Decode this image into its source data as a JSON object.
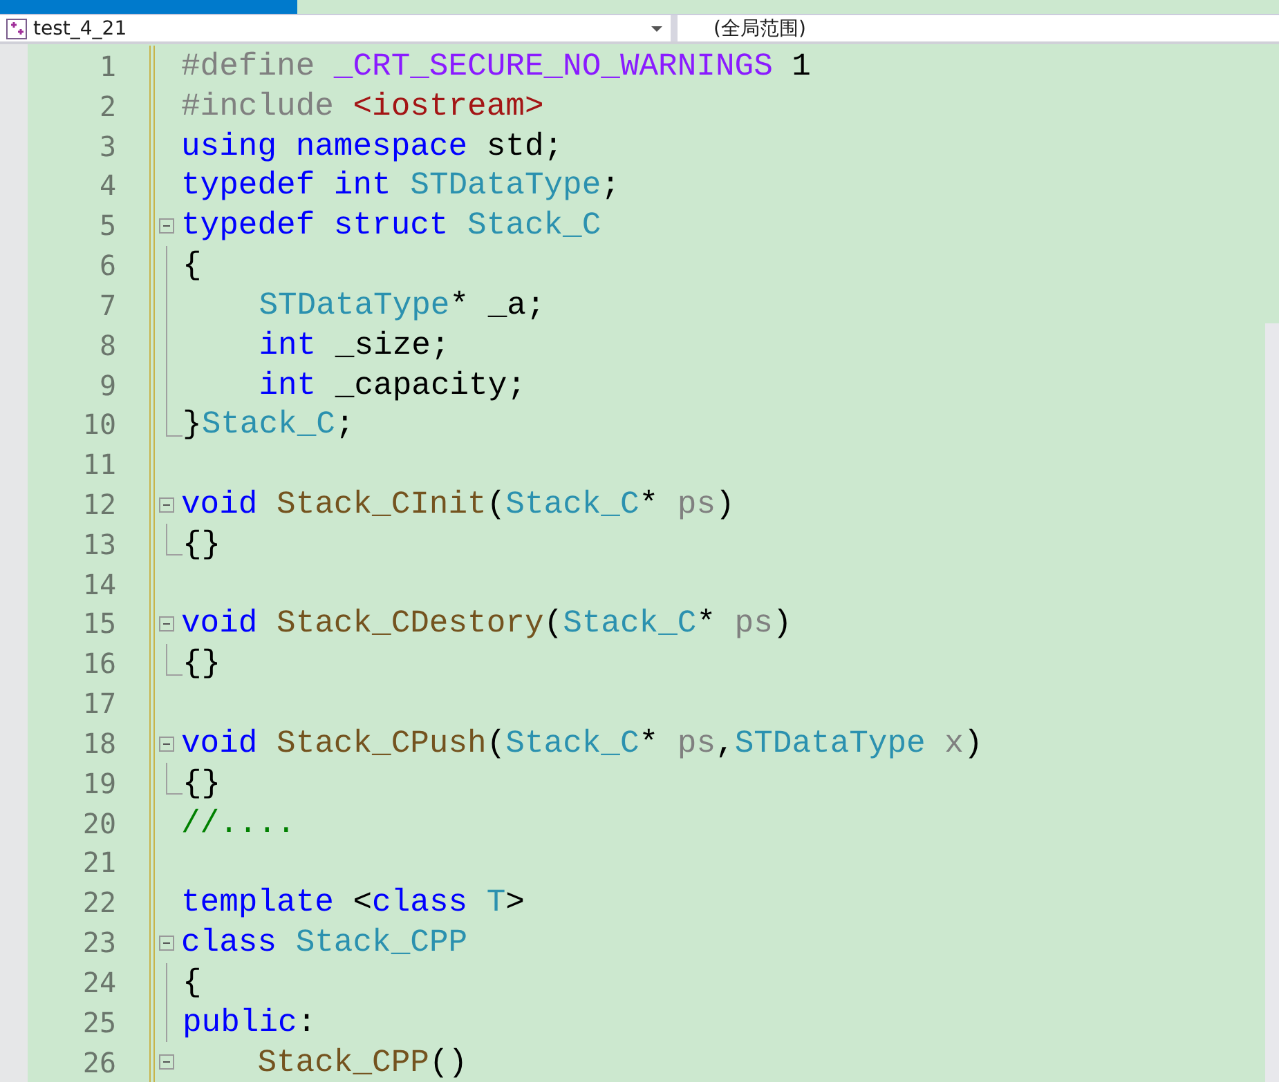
{
  "navigation_bar": {
    "project": "test_4_21",
    "scope": "(全局范围)"
  },
  "editor": {
    "lines": [
      {
        "number": "1",
        "kind": "plain",
        "tokens": [
          {
            "kind": "pre",
            "text": "#define "
          },
          {
            "kind": "macro",
            "text": "_CRT_SECURE_NO_WARNINGS"
          },
          {
            "kind": "plain",
            "text": " 1"
          }
        ]
      },
      {
        "number": "2",
        "kind": "plain",
        "tokens": [
          {
            "kind": "pre",
            "text": "#include "
          },
          {
            "kind": "str",
            "text": "<iostream>"
          }
        ]
      },
      {
        "number": "3",
        "kind": "plain",
        "tokens": [
          {
            "kind": "kw",
            "text": "using namespace"
          },
          {
            "kind": "plain",
            "text": " std;"
          }
        ]
      },
      {
        "number": "4",
        "kind": "plain",
        "tokens": [
          {
            "kind": "kw",
            "text": "typedef int "
          },
          {
            "kind": "type",
            "text": "STDataType"
          },
          {
            "kind": "plain",
            "text": ";"
          }
        ]
      },
      {
        "number": "5",
        "kind": "fold_start",
        "tokens": [
          {
            "kind": "kw",
            "text": "typedef struct "
          },
          {
            "kind": "type",
            "text": "Stack_C"
          }
        ]
      },
      {
        "number": "6",
        "kind": "fold_body",
        "tokens": [
          {
            "kind": "plain",
            "text": "{"
          }
        ]
      },
      {
        "number": "7",
        "kind": "fold_body",
        "indented": true,
        "tokens": [
          {
            "kind": "type",
            "text": "STDataType"
          },
          {
            "kind": "plain",
            "text": "* _a;"
          }
        ]
      },
      {
        "number": "8",
        "kind": "fold_body",
        "indented": true,
        "tokens": [
          {
            "kind": "kw",
            "text": "int"
          },
          {
            "kind": "plain",
            "text": " _size;"
          }
        ]
      },
      {
        "number": "9",
        "kind": "fold_body",
        "indented": true,
        "tokens": [
          {
            "kind": "kw",
            "text": "int"
          },
          {
            "kind": "plain",
            "text": " _capacity;"
          }
        ]
      },
      {
        "number": "10",
        "kind": "fold_end",
        "tokens": [
          {
            "kind": "plain",
            "text": "}"
          },
          {
            "kind": "type",
            "text": "Stack_C"
          },
          {
            "kind": "plain",
            "text": ";"
          }
        ]
      },
      {
        "number": "11",
        "kind": "plain"
      },
      {
        "number": "12",
        "kind": "fold_start",
        "tokens": [
          {
            "kind": "kw",
            "text": "void "
          },
          {
            "kind": "fn",
            "text": "Stack_CInit"
          },
          {
            "kind": "plain",
            "text": "("
          },
          {
            "kind": "type",
            "text": "Stack_C"
          },
          {
            "kind": "plain",
            "text": "* "
          },
          {
            "kind": "param",
            "text": "ps"
          },
          {
            "kind": "plain",
            "text": ")"
          }
        ]
      },
      {
        "number": "13",
        "kind": "fold_end",
        "tokens": [
          {
            "kind": "plain",
            "text": "{}"
          }
        ]
      },
      {
        "number": "14",
        "kind": "plain"
      },
      {
        "number": "15",
        "kind": "fold_start",
        "tokens": [
          {
            "kind": "kw",
            "text": "void "
          },
          {
            "kind": "fn",
            "text": "Stack_CDestory"
          },
          {
            "kind": "plain",
            "text": "("
          },
          {
            "kind": "type",
            "text": "Stack_C"
          },
          {
            "kind": "plain",
            "text": "* "
          },
          {
            "kind": "param",
            "text": "ps"
          },
          {
            "kind": "plain",
            "text": ")"
          }
        ]
      },
      {
        "number": "16",
        "kind": "fold_end",
        "tokens": [
          {
            "kind": "plain",
            "text": "{}"
          }
        ]
      },
      {
        "number": "17",
        "kind": "plain"
      },
      {
        "number": "18",
        "kind": "fold_start",
        "tokens": [
          {
            "kind": "kw",
            "text": "void "
          },
          {
            "kind": "fn",
            "text": "Stack_CPush"
          },
          {
            "kind": "plain",
            "text": "("
          },
          {
            "kind": "type",
            "text": "Stack_C"
          },
          {
            "kind": "plain",
            "text": "* "
          },
          {
            "kind": "param",
            "text": "ps"
          },
          {
            "kind": "plain",
            "text": ","
          },
          {
            "kind": "type",
            "text": "STDataType "
          },
          {
            "kind": "param",
            "text": "x"
          },
          {
            "kind": "plain",
            "text": ")"
          }
        ]
      },
      {
        "number": "19",
        "kind": "fold_end",
        "tokens": [
          {
            "kind": "plain",
            "text": "{}"
          }
        ]
      },
      {
        "number": "20",
        "kind": "plain",
        "tokens": [
          {
            "kind": "comment",
            "text": "//...."
          }
        ]
      },
      {
        "number": "21",
        "kind": "plain"
      },
      {
        "number": "22",
        "kind": "plain",
        "tokens": [
          {
            "kind": "kw",
            "text": "template"
          },
          {
            "kind": "plain",
            "text": " <"
          },
          {
            "kind": "kw",
            "text": "class "
          },
          {
            "kind": "type",
            "text": "T"
          },
          {
            "kind": "plain",
            "text": ">"
          }
        ]
      },
      {
        "number": "23",
        "kind": "fold_start",
        "tokens": [
          {
            "kind": "kw",
            "text": "class "
          },
          {
            "kind": "type",
            "text": "Stack_CPP"
          }
        ]
      },
      {
        "number": "24",
        "kind": "fold_body",
        "tokens": [
          {
            "kind": "plain",
            "text": "{"
          }
        ]
      },
      {
        "number": "25",
        "kind": "fold_body",
        "tokens": [
          {
            "kind": "kw",
            "text": "public"
          },
          {
            "kind": "plain",
            "text": ":"
          }
        ]
      },
      {
        "number": "26",
        "kind": "fold_start",
        "indented": true,
        "tokens": [
          {
            "kind": "fn",
            "text": "Stack_CPP"
          },
          {
            "kind": "plain",
            "text": "()"
          }
        ]
      }
    ]
  }
}
